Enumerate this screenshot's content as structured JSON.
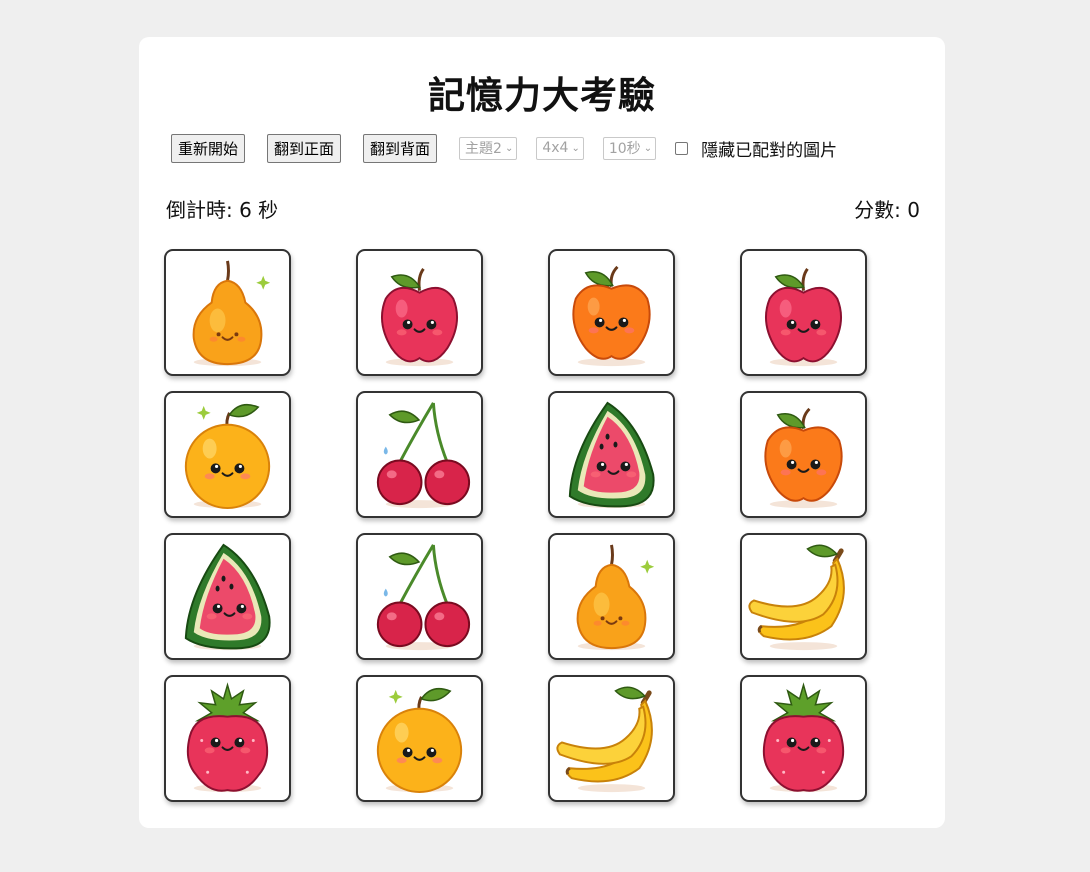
{
  "header": {
    "title": "記憶力大考驗"
  },
  "toolbar": {
    "restart_label": "重新開始",
    "flip_front_label": "翻到正面",
    "flip_back_label": "翻到背面",
    "theme_value": "主題2",
    "size_value": "4x4",
    "time_value": "10秒",
    "hide_matched_label": "隱藏已配對的圖片",
    "hide_matched_checked": false
  },
  "status": {
    "timer_label": "倒計時: 6 秒",
    "score_label": "分數: 0"
  },
  "board": {
    "rows": 4,
    "cols": 4,
    "cards": [
      {
        "fruit": "pear-icon"
      },
      {
        "fruit": "apple-icon"
      },
      {
        "fruit": "orange-apple-icon"
      },
      {
        "fruit": "apple-icon"
      },
      {
        "fruit": "orange-icon"
      },
      {
        "fruit": "cherry-icon"
      },
      {
        "fruit": "watermelon-icon"
      },
      {
        "fruit": "orange-apple-icon"
      },
      {
        "fruit": "watermelon-icon"
      },
      {
        "fruit": "cherry-icon"
      },
      {
        "fruit": "pear-icon"
      },
      {
        "fruit": "banana-icon"
      },
      {
        "fruit": "strawberry-icon"
      },
      {
        "fruit": "orange-icon"
      },
      {
        "fruit": "banana-icon"
      },
      {
        "fruit": "strawberry-icon"
      }
    ]
  },
  "colors": {
    "page_bg": "#efefef",
    "panel_bg": "#ffffff",
    "card_border": "#333333"
  }
}
